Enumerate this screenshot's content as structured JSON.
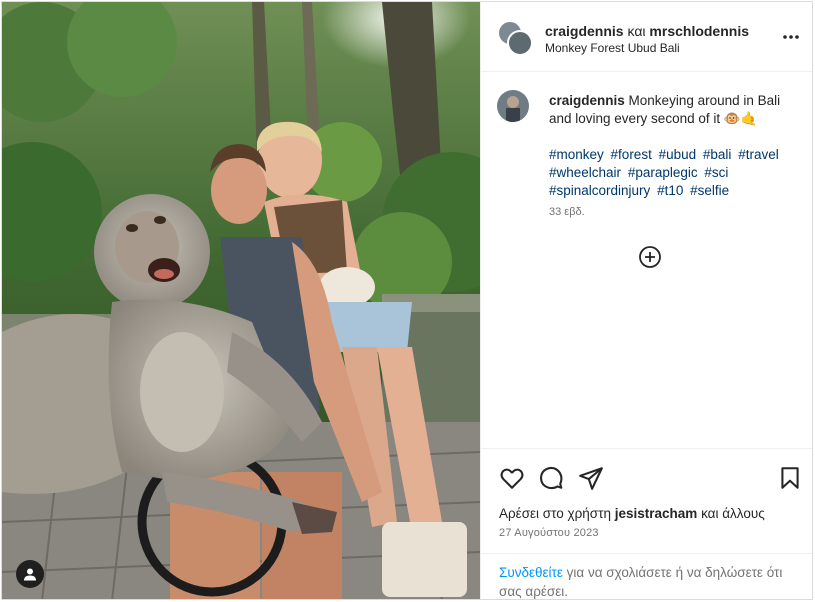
{
  "post": {
    "header": {
      "user1": "craigdennis",
      "and_word": "και",
      "user2": "mrschlodennis",
      "location": "Monkey Forest Ubud Bali",
      "more_icon": "more-horizontal-icon"
    },
    "caption": {
      "username": "craigdennis",
      "text": "Monkeying around in Bali and loving every second of it 🐵🤙",
      "hashtags": [
        "#monkey",
        "#forest",
        "#ubud",
        "#bali",
        "#travel",
        "#wheelchair",
        "#paraplegic",
        "#sci",
        "#spinalcordinjury",
        "#t10",
        "#selfie"
      ],
      "time": "33 εβδ."
    },
    "actions": {
      "like_icon": "heart-icon",
      "comment_icon": "comment-icon",
      "share_icon": "send-icon",
      "save_icon": "bookmark-icon"
    },
    "likes": {
      "prefix": "Αρέσει στο χρήστη",
      "user": "jesistracham",
      "suffix": "και άλλους"
    },
    "date": "27 Αυγούστου 2023",
    "login_prompt": {
      "link": "Συνδεθείτε",
      "rest": "για να σχολιάσετε ή να δηλώσετε ότι σας αρέσει."
    },
    "colors": {
      "link_blue": "#0095f6",
      "hashtag": "#00376b",
      "muted": "#737373",
      "border": "#dbdbdb"
    }
  }
}
